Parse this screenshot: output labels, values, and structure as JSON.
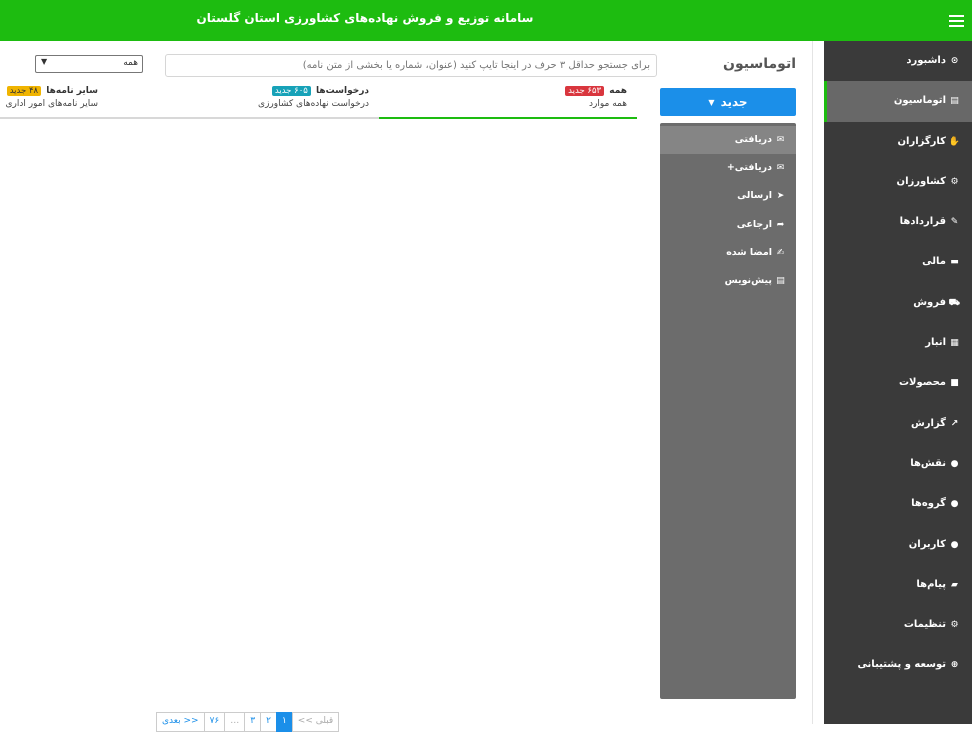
{
  "header": {
    "title": "سامانه توزیع و فروش نهاده‌های کشاورزی استان گلستان"
  },
  "sidebar": {
    "items": [
      {
        "label": "داشبورد",
        "icon": "tachometer-icon",
        "glyph": "⊙"
      },
      {
        "label": "اتوماسیون",
        "icon": "file-text-icon",
        "glyph": "▤",
        "active": true
      },
      {
        "label": "کارگزاران",
        "icon": "handshake-icon",
        "glyph": "✋"
      },
      {
        "label": "کشاورزان",
        "icon": "tractor-icon",
        "glyph": "⚙"
      },
      {
        "label": "قراردادها",
        "icon": "contract-icon",
        "glyph": "✎"
      },
      {
        "label": "مالی",
        "icon": "credit-card-icon",
        "glyph": "▬"
      },
      {
        "label": "فروش",
        "icon": "shopping-cart-icon",
        "glyph": "⛟"
      },
      {
        "label": "انبار",
        "icon": "warehouse-icon",
        "glyph": "▦"
      },
      {
        "label": "محصولات",
        "icon": "box-icon",
        "glyph": "■"
      },
      {
        "label": "گزارش",
        "icon": "chart-line-icon",
        "glyph": "↗"
      },
      {
        "label": "نقش‌ها",
        "icon": "user-tag-icon",
        "glyph": "●"
      },
      {
        "label": "گروه‌ها",
        "icon": "users-group-icon",
        "glyph": "●"
      },
      {
        "label": "کاربران",
        "icon": "users-icon",
        "glyph": "●"
      },
      {
        "label": "پیام‌ها",
        "icon": "comment-icon",
        "glyph": "▰"
      },
      {
        "label": "تنظیمات",
        "icon": "cogs-icon",
        "glyph": "⚙"
      },
      {
        "label": "توسعه و پشتیبانی",
        "icon": "globe-icon",
        "glyph": "⊕"
      }
    ]
  },
  "main": {
    "title": "اتوماسیون",
    "search_placeholder": "برای جستجو حداقل ۳ حرف در اینجا تایپ کنید (عنوان، شماره یا بخشی از متن نامه)",
    "filter_value": "همه",
    "new_button": "جدید",
    "folders": [
      {
        "label": "دریافتی",
        "icon": "envelope-icon",
        "glyph": "✉",
        "active": true
      },
      {
        "label": "دریافتی+",
        "icon": "envelope-open-icon",
        "glyph": "✉"
      },
      {
        "label": "ارسالی",
        "icon": "paper-plane-icon",
        "glyph": "➤"
      },
      {
        "label": "ارجاعی",
        "icon": "share-icon",
        "glyph": "➦"
      },
      {
        "label": "امضا شده",
        "icon": "signature-icon",
        "glyph": "✍"
      },
      {
        "label": "پیش‌نویس",
        "icon": "file-draft-icon",
        "glyph": "▤"
      }
    ],
    "tabs": [
      {
        "title": "همه",
        "badge": "۶۵۳ جدید",
        "subtitle": "همه موارد"
      },
      {
        "title": "درخواست‌ها",
        "badge": "۶۰۵ جدید",
        "subtitle": "درخواست نهاده‌های کشاورزی"
      },
      {
        "title": "سایر نامه‌ها",
        "badge": "۴۸ جدید",
        "subtitle": "سایر نامه‌های امور اداری"
      }
    ],
    "pagination": {
      "prev": "<< قبلی",
      "pages": [
        "۱",
        "۲",
        "۳"
      ],
      "ellipsis": "…",
      "last": "۷۶",
      "next": "بعدی >>"
    }
  },
  "colors": {
    "header_green": "#1dbc10",
    "sidebar_dark": "#3a3a3a",
    "primary_blue": "#1b8fe9",
    "folder_gray": "#6c6c6c"
  }
}
